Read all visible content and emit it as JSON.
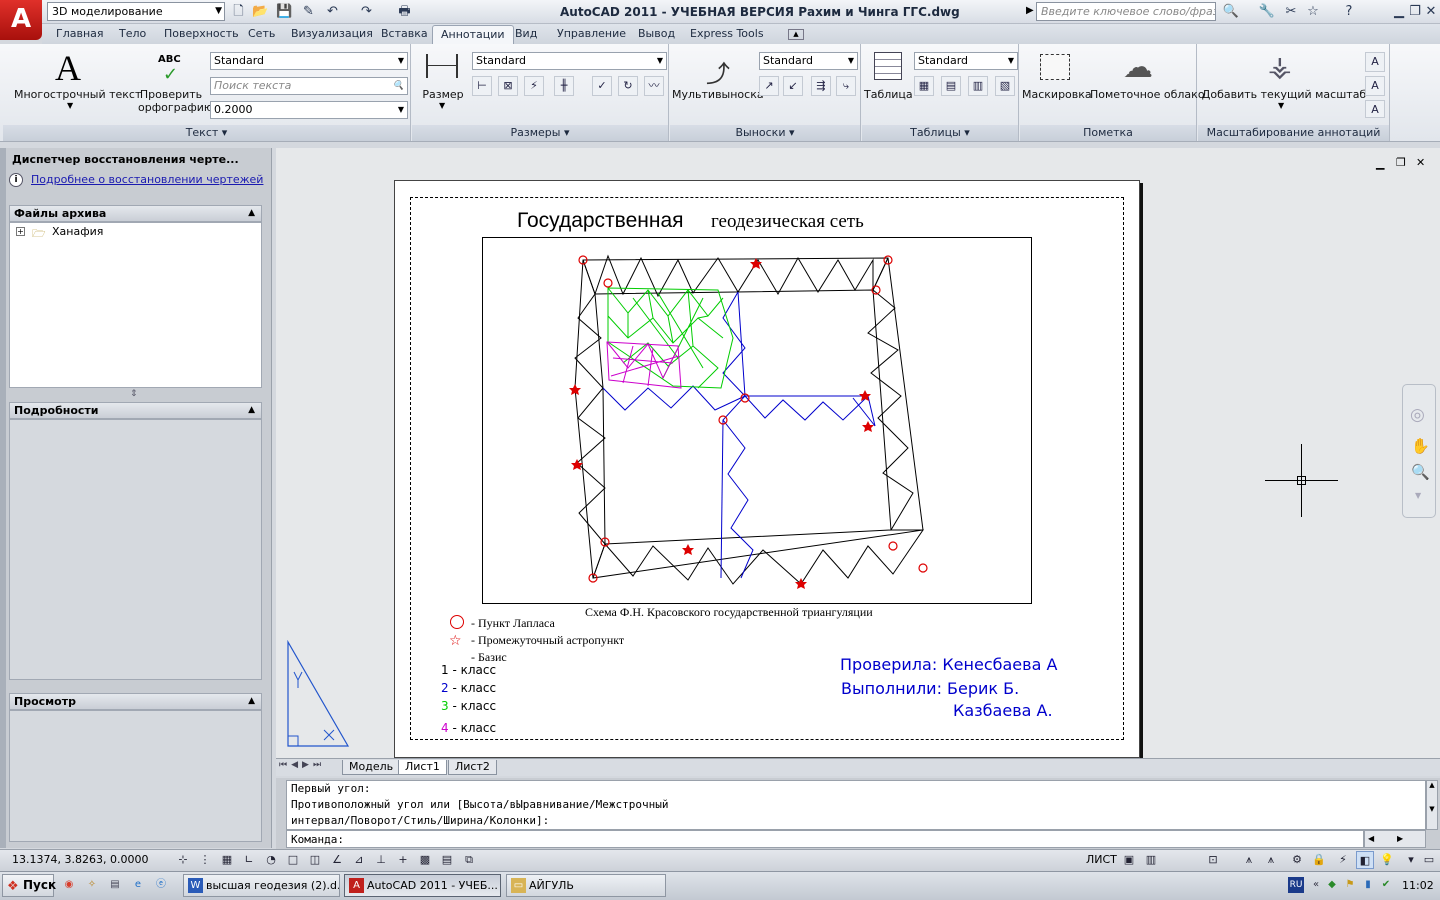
{
  "window": {
    "logo": "A",
    "workspace": "3D моделирование",
    "title": "AutoCAD 2011 - УЧЕБНАЯ ВЕРСИЯ    Рахим и Чинга ГГС.dwg",
    "search_placeholder": "Введите ключевое слово/фразу"
  },
  "tabs": [
    "Главная",
    "Тело",
    "Поверхность",
    "Сеть",
    "Визуализация",
    "Вставка",
    "Аннотации",
    "Вид",
    "Управление",
    "Вывод",
    "Express Tools"
  ],
  "active_tab": "Аннотации",
  "ribbon": {
    "text_panel": {
      "title": "Текст",
      "mtext_label": "Многострочный текст",
      "spell_label_1": "Проверить",
      "spell_label_2": "орфографию",
      "spell_badge": "ABC",
      "style_value": "Standard",
      "find_placeholder": "Поиск текста",
      "height_value": "0.2000"
    },
    "dim_panel": {
      "title": "Размеры",
      "dim_label": "Размер",
      "style_value": "Standard"
    },
    "leader_panel": {
      "title": "Выноски",
      "mleader_label": "Мультивыноска",
      "style_value": "Standard"
    },
    "table_panel": {
      "title": "Таблицы",
      "table_label": "Таблица",
      "style_value": "Standard"
    },
    "markup_panel": {
      "title": "Пометка",
      "wipeout_label": "Маскировка",
      "revcloud_label": "Пометочное облако"
    },
    "scale_panel": {
      "title": "Масштабирование аннотаций",
      "add_scale_label": "Добавить текущий масштаб"
    }
  },
  "palette": {
    "title": "Диспетчер восстановления черте...",
    "info_link": "Подробнее о восстановлении чертежей",
    "files_header": "Файлы архива",
    "tree_item": "Ханафия",
    "details_header": "Подробности",
    "preview_header": "Просмотр"
  },
  "drawing": {
    "title_part1": "Государственная",
    "title_part2": "геодезическая сеть",
    "caption": "Схема Ф.Н. Красовского государственной триангуляции",
    "legend": {
      "laplace": "- Пункт Лапласа",
      "astro": "- Промежуточный астропункт",
      "basis": "- Базис",
      "class1_num": "1",
      "class1": " - класс",
      "class2_num": "2",
      "class2": " - класс",
      "class3_num": "3",
      "class3": " - класс",
      "class4_num": "4",
      "class4": " - класс"
    },
    "checked": "Проверила: Кенесбаева А",
    "done": "Выполнили: Берик Б.",
    "done2": "Казбаева А.",
    "colors": {
      "class1": "#000000",
      "class2": "#0000cc",
      "class3": "#00cc00",
      "class4": "#cc00cc",
      "points": "#dd0000",
      "signature": "#0000cc"
    }
  },
  "layout_tabs": [
    "Модель",
    "Лист1",
    "Лист2"
  ],
  "active_layout": "Лист1",
  "command": {
    "history": "Первый угол:\nПротивоположный угол или [Высота/вЫравнивание/Межстрочный\nинтервал/Поворот/Стиль/Ширина/Колонки]:",
    "prompt": "Команда:"
  },
  "status": {
    "coords": "13.1374, 3.8263, 0.0000",
    "space": "ЛИСТ"
  },
  "taskbar": {
    "start": "Пуск",
    "tasks": [
      "высшая геодезия (2).d...",
      "AutoCAD 2011 - УЧЕБ...",
      "АЙГУЛЬ"
    ],
    "lang": "RU",
    "time": "11:02"
  }
}
